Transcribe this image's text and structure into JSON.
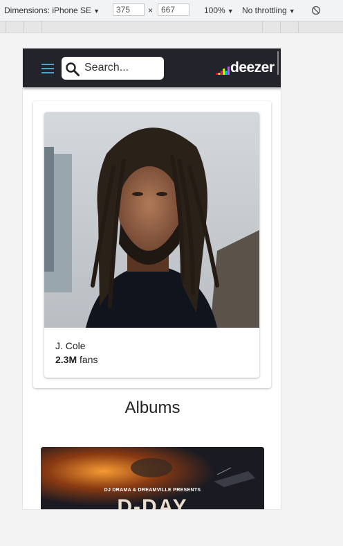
{
  "devtools": {
    "dimensions_label": "Dimensions: iPhone SE",
    "width_value": "375",
    "height_value": "667",
    "times": "×",
    "zoom": "100%",
    "throttling": "No throttling"
  },
  "header": {
    "search_placeholder": "Search...",
    "logo_text": "deezer",
    "logo_bar_colors": [
      "#ff0000",
      "#ffed00",
      "#ff0092",
      "#c2ff00",
      "#00c7f2",
      "#bd55ff"
    ]
  },
  "artist": {
    "name": "J. Cole",
    "fans_count": "2.3M",
    "fans_label": "fans"
  },
  "albums": {
    "title": "Albums",
    "first_cover_line1": "DJ DRAMA & DREAMVILLE PRESENTS",
    "first_cover_line2": "D-DAY"
  }
}
